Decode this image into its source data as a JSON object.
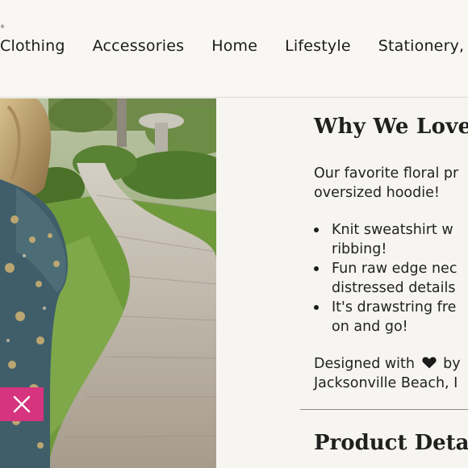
{
  "nav": {
    "trademark": "®",
    "items": [
      "Clothing",
      "Accessories",
      "Home",
      "Lifestyle",
      "Stationery, I"
    ]
  },
  "product": {
    "why_heading": "Why We Love I",
    "intro_lines": [
      "Our favorite floral pr",
      "oversized hoodie!"
    ],
    "bullets": [
      [
        "Knit sweatshirt w",
        "ribbing!"
      ],
      [
        "Fun raw edge nec",
        "distressed details"
      ],
      [
        "It's drawstring fre",
        "on and go!"
      ]
    ],
    "designed_prefix": "Designed with",
    "designed_suffix": "by",
    "designed_line2": "Jacksonville Beach, I",
    "details_heading": "Product Details"
  },
  "colors": {
    "accent": "#d6347f",
    "background": "#f7f6f2"
  },
  "icons": {
    "close": "close-icon",
    "heart": "heart-icon"
  }
}
